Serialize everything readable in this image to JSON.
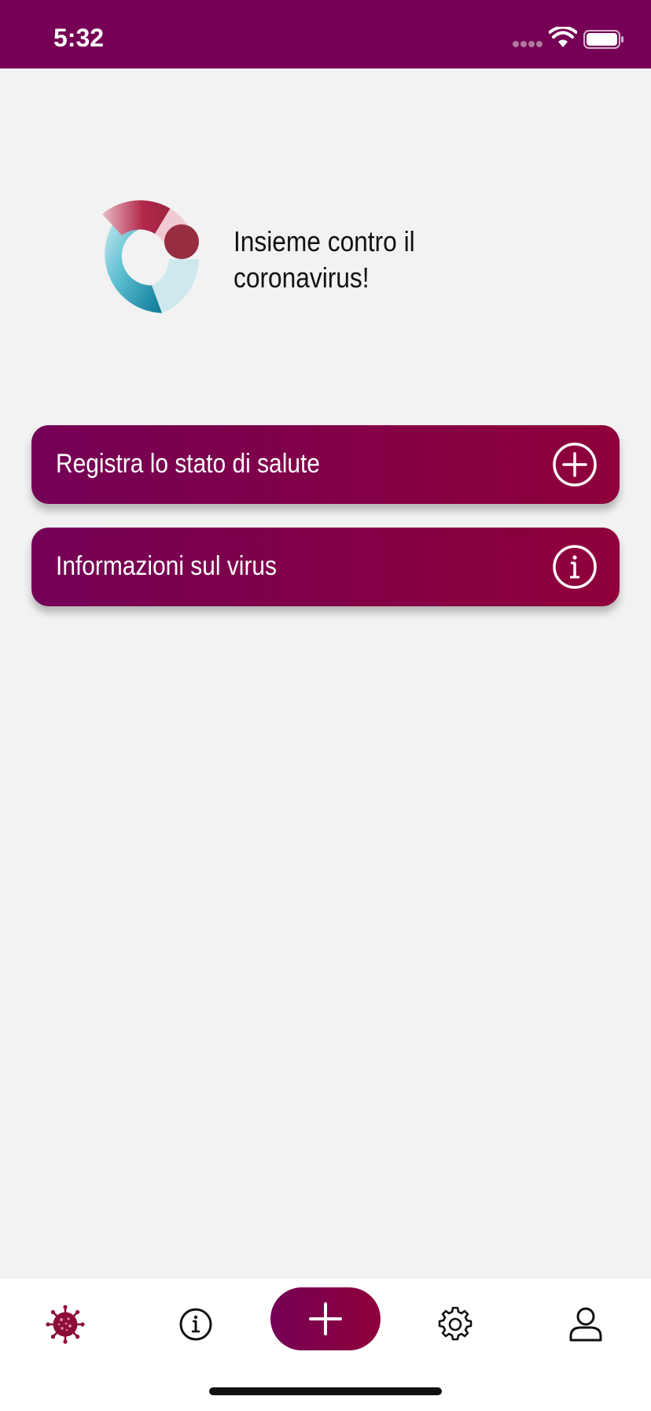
{
  "status_bar": {
    "time": "5:32",
    "background": "#750055"
  },
  "hero": {
    "logo_icon": "ring-logo-icon",
    "title": "Insieme contro il coronavirus!"
  },
  "actions": [
    {
      "label": "Registra lo stato di salute",
      "icon": "plus-circle-icon"
    },
    {
      "label": "Informazioni sul virus",
      "icon": "info-circle-icon"
    }
  ],
  "tab_bar": {
    "items": [
      {
        "icon": "virus-icon",
        "active": true
      },
      {
        "icon": "info-icon",
        "active": false
      },
      {
        "icon": "plus-icon",
        "active": false
      },
      {
        "icon": "gear-icon",
        "active": false
      },
      {
        "icon": "user-icon",
        "active": false
      }
    ]
  },
  "colors": {
    "brand_start": "#740056",
    "brand_end": "#8f003a",
    "background": "#f2f2f2",
    "active_tab": "#8c0d3a"
  }
}
